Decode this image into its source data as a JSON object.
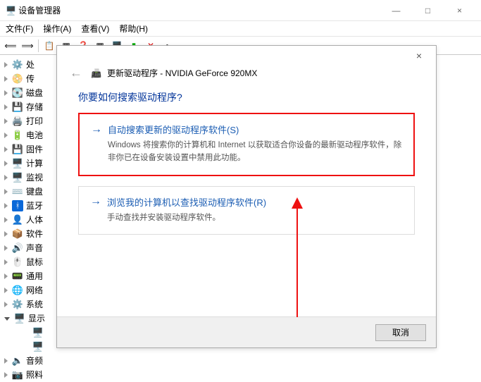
{
  "window": {
    "title": "设备管理器",
    "min": "—",
    "max": "□",
    "close": "×"
  },
  "menu": {
    "file": "文件(F)",
    "action": "操作(A)",
    "view": "查看(V)",
    "help": "帮助(H)"
  },
  "tree": {
    "items": [
      {
        "icon": "⚙️",
        "label": "处"
      },
      {
        "icon": "📀",
        "label": "传"
      },
      {
        "icon": "💽",
        "label": "磁盘"
      },
      {
        "icon": "💾",
        "label": "存储"
      },
      {
        "icon": "🖨️",
        "label": "打印"
      },
      {
        "icon": "🔋",
        "label": "电池"
      },
      {
        "icon": "💾",
        "label": "固件"
      },
      {
        "icon": "🖥️",
        "label": "计算"
      },
      {
        "icon": "🖥️",
        "label": "监视"
      },
      {
        "icon": "⌨️",
        "label": "键盘"
      },
      {
        "icon": "ᚼ",
        "label": "蓝牙",
        "bt": true
      },
      {
        "icon": "👤",
        "label": "人体"
      },
      {
        "icon": "📦",
        "label": "软件"
      },
      {
        "icon": "🔊",
        "label": "声音"
      },
      {
        "icon": "🖱️",
        "label": "鼠标"
      },
      {
        "icon": "📟",
        "label": "通用"
      },
      {
        "icon": "🌐",
        "label": "网络"
      },
      {
        "icon": "⚙️",
        "label": "系统"
      },
      {
        "icon": "🖥️",
        "label": "显示",
        "exp": true
      }
    ],
    "sub": [
      {
        "icon": "🖥️"
      },
      {
        "icon": "🖥️"
      }
    ],
    "tail": [
      {
        "icon": "🔈",
        "label": "音频"
      },
      {
        "icon": "📷",
        "label": "照料"
      }
    ]
  },
  "dialog": {
    "close": "×",
    "back": "←",
    "title": "更新驱动程序 - NVIDIA GeForce 920MX",
    "question": "你要如何搜索驱动程序?",
    "opt1": {
      "title": "自动搜索更新的驱动程序软件(S)",
      "sub": "Windows 将搜索你的计算机和 Internet 以获取适合你设备的最新驱动程序软件，除非你已在设备安装设置中禁用此功能。"
    },
    "opt2": {
      "title": "浏览我的计算机以查找驱动程序软件(R)",
      "sub": "手动查找并安装驱动程序软件。"
    },
    "cancel": "取消"
  }
}
